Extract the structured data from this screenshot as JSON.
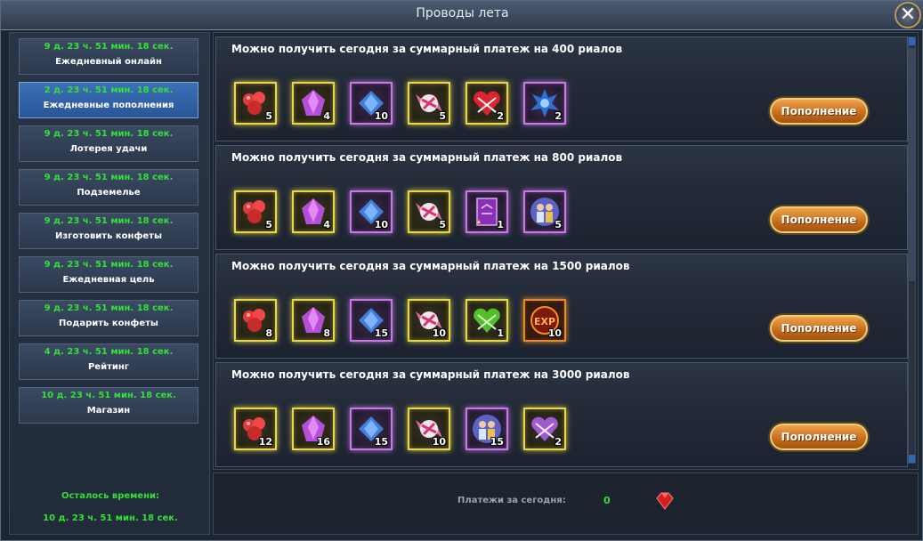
{
  "window": {
    "title": "Проводы лета"
  },
  "sidebar": {
    "items": [
      {
        "time": "9 д. 23 ч. 51 мин. 18 сек.",
        "label": "Ежедневный онлайн",
        "active": false
      },
      {
        "time": "2 д. 23 ч. 51 мин. 18 сек.",
        "label": "Ежедневные пополнения",
        "active": true
      },
      {
        "time": "9 д. 23 ч. 51 мин. 18 сек.",
        "label": "Лотерея удачи",
        "active": false
      },
      {
        "time": "9 д. 23 ч. 51 мин. 18 сек.",
        "label": "Подземелье",
        "active": false
      },
      {
        "time": "9 д. 23 ч. 51 мин. 18 сек.",
        "label": "Изготовить конфеты",
        "active": false
      },
      {
        "time": "9 д. 23 ч. 51 мин. 18 сек.",
        "label": "Ежедневная цель",
        "active": false
      },
      {
        "time": "9 д. 23 ч. 51 мин. 18 сек.",
        "label": "Подарить конфеты",
        "active": false
      },
      {
        "time": "4 д. 23 ч. 51 мин. 18 сек.",
        "label": "Рейтинг",
        "active": false
      },
      {
        "time": "10 д. 23 ч. 51 мин. 18 сек.",
        "label": "Магазин",
        "active": false
      }
    ],
    "remaining_label": "Осталось времени:",
    "remaining_time": "10 д. 23 ч. 51 мин. 18 сек."
  },
  "tiers": [
    {
      "title": "Можно получить сегодня за суммарный платеж на 400 риалов",
      "button_label": "Пополнение",
      "rewards": [
        {
          "icon": "red-candies-icon",
          "count": "5",
          "frame": "gold"
        },
        {
          "icon": "purple-crystal-icon",
          "count": "4",
          "frame": "gold"
        },
        {
          "icon": "blue-gem-icon",
          "count": "10",
          "frame": "purple"
        },
        {
          "icon": "wrapped-candy-icon",
          "count": "5",
          "frame": "gold"
        },
        {
          "icon": "red-gift-box-icon",
          "count": "2",
          "frame": "gold"
        },
        {
          "icon": "blue-spiky-pet-icon",
          "count": "2",
          "frame": "purple"
        }
      ]
    },
    {
      "title": "Можно получить сегодня за суммарный платеж на 800 риалов",
      "button_label": "Пополнение",
      "rewards": [
        {
          "icon": "red-candies-icon",
          "count": "5",
          "frame": "gold"
        },
        {
          "icon": "purple-crystal-icon",
          "count": "4",
          "frame": "gold"
        },
        {
          "icon": "blue-gem-icon",
          "count": "10",
          "frame": "purple"
        },
        {
          "icon": "wrapped-candy-icon",
          "count": "5",
          "frame": "gold"
        },
        {
          "icon": "purple-scroll-icon",
          "count": "1",
          "frame": "purple"
        },
        {
          "icon": "couple-portrait-icon",
          "count": "5",
          "frame": "purple"
        }
      ]
    },
    {
      "title": "Можно получить сегодня за суммарный платеж на 1500 риалов",
      "button_label": "Пополнение",
      "rewards": [
        {
          "icon": "red-candies-icon",
          "count": "8",
          "frame": "gold"
        },
        {
          "icon": "purple-crystal-icon",
          "count": "8",
          "frame": "gold"
        },
        {
          "icon": "blue-gem-icon",
          "count": "15",
          "frame": "purple"
        },
        {
          "icon": "wrapped-candy-icon",
          "count": "10",
          "frame": "gold"
        },
        {
          "icon": "green-gift-box-icon",
          "count": "1",
          "frame": "gold"
        },
        {
          "icon": "exp-orb-icon",
          "count": "10",
          "frame": "orange"
        }
      ]
    },
    {
      "title": "Можно получить сегодня за суммарный платеж на 3000 риалов",
      "button_label": "Пополнение",
      "rewards": [
        {
          "icon": "red-candies-icon",
          "count": "12",
          "frame": "gold"
        },
        {
          "icon": "purple-crystal-icon",
          "count": "16",
          "frame": "gold"
        },
        {
          "icon": "blue-gem-icon",
          "count": "15",
          "frame": "purple"
        },
        {
          "icon": "wrapped-candy-icon",
          "count": "10",
          "frame": "gold"
        },
        {
          "icon": "couple-portrait-icon",
          "count": "15",
          "frame": "purple"
        },
        {
          "icon": "purple-gift-box-icon",
          "count": "2",
          "frame": "gold"
        }
      ]
    }
  ],
  "footer": {
    "payments_label": "Платежи за сегодня:",
    "payments_value": "0"
  },
  "colors": {
    "accent_green": "#33e033",
    "active_tab": "#2f62ad",
    "button_orange": "#c46a1c",
    "frame_gold": "#e6d84a",
    "frame_purple": "#c57ae6"
  }
}
